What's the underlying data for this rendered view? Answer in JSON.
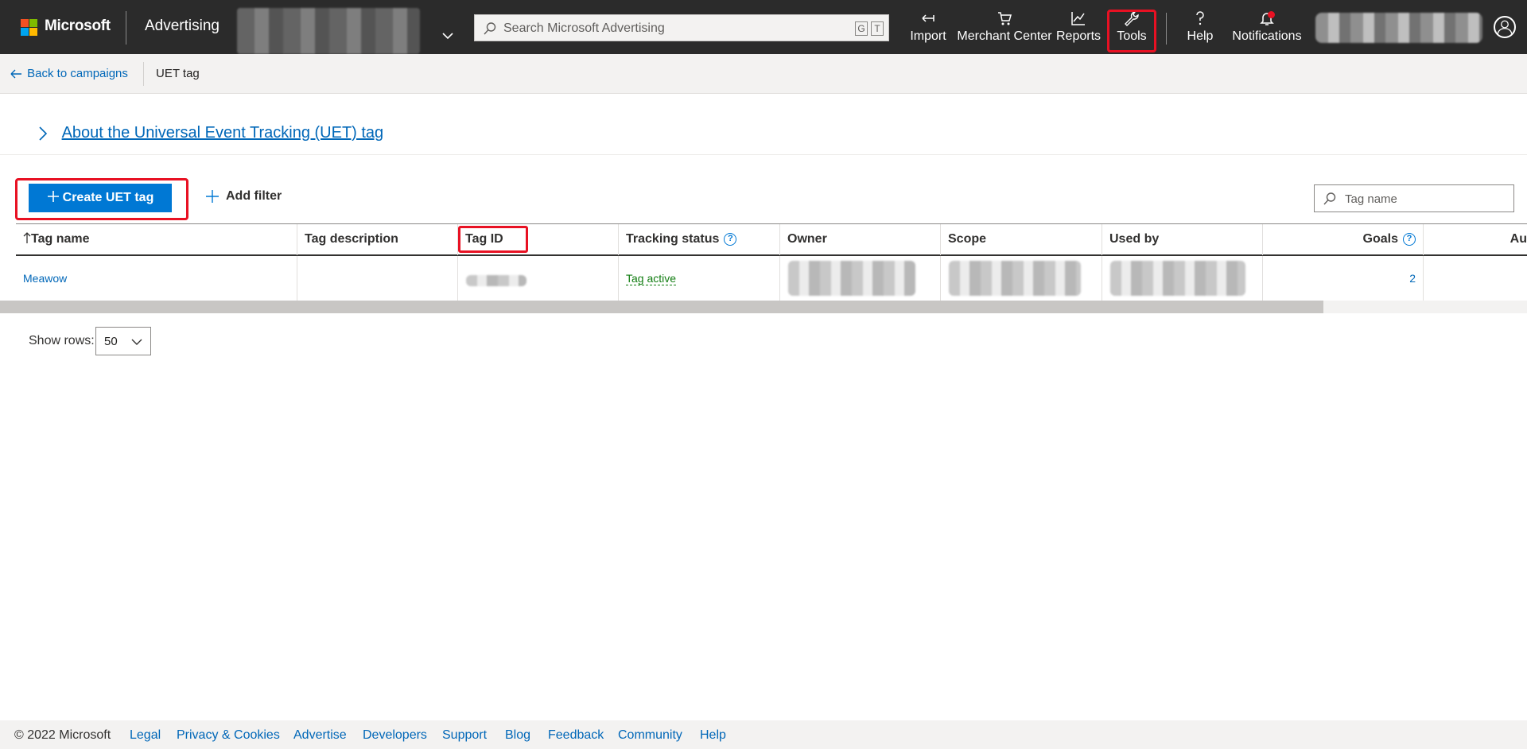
{
  "header": {
    "brand": "Microsoft",
    "product": "Advertising",
    "search_placeholder": "Search Microsoft Advertising",
    "search_key1": "G",
    "search_key2": "T",
    "nav": {
      "import": "Import",
      "merchant_center": "Merchant Center",
      "reports": "Reports",
      "tools": "Tools",
      "help": "Help",
      "notifications": "Notifications"
    }
  },
  "subheader": {
    "back": "Back to campaigns",
    "title": "UET tag"
  },
  "about": {
    "link": "About the Universal Event Tracking (UET) tag"
  },
  "toolbar": {
    "create": "Create UET tag",
    "add_filter": "Add filter",
    "search_placeholder": "Tag name"
  },
  "table": {
    "columns": {
      "tag_name": "Tag name",
      "tag_description": "Tag description",
      "tag_id": "Tag ID",
      "tracking_status": "Tracking status",
      "owner": "Owner",
      "scope": "Scope",
      "used_by": "Used by",
      "goals": "Goals",
      "auto": "Au"
    },
    "rows": [
      {
        "tag_name": "Meawow",
        "tag_description": "",
        "tracking_status": "Tag active",
        "goals": "2"
      }
    ]
  },
  "pagination": {
    "label": "Show rows:",
    "value": "50"
  },
  "footer": {
    "copyright": "© 2022 Microsoft",
    "links": [
      "Legal",
      "Privacy & Cookies",
      "Advertise",
      "Developers",
      "Support",
      "Blog",
      "Feedback",
      "Community",
      "Help"
    ]
  },
  "colors": {
    "topbar": "#2b2b2b",
    "accent": "#0078d4",
    "link": "#0067b8",
    "highlight": "#e81123",
    "status_active": "#107c10"
  }
}
